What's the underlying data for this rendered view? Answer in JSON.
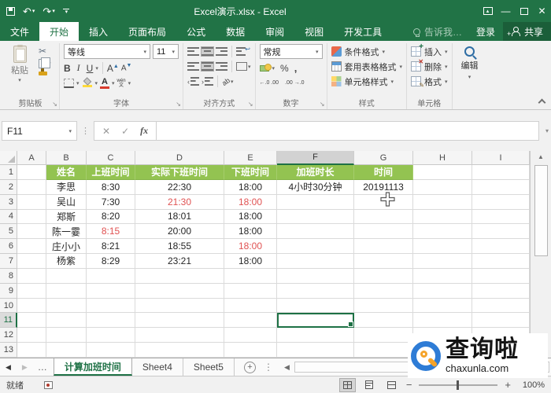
{
  "window": {
    "title": "Excel演示.xlsx - Excel"
  },
  "icons": {
    "undo": "↶",
    "redo": "↷",
    "dropdown": "▾",
    "close": "✕",
    "minimize": "—",
    "check": "✓",
    "cancel": "✕",
    "fx": "fx",
    "dots_v": "⋮",
    "ellipsis": "…",
    "tri_left": "◀",
    "tri_right": "▶",
    "up": "▲",
    "down": "▼",
    "scissors": "✂",
    "percent": "%",
    "comma": ",",
    "plus": "+",
    "minus": "−",
    "indent_left": "‹",
    "indent_right": "›",
    "wrap_return": "↩",
    "dec_increase": "←.0 .00",
    "dec_decrease": ".00 →.0",
    "launcher": "↘",
    "ribbon_display": "▴"
  },
  "tabs": {
    "file": "文件",
    "items": [
      "开始",
      "插入",
      "页面布局",
      "公式",
      "数据",
      "审阅",
      "视图",
      "开发工具"
    ],
    "active": "开始",
    "tell_me": "告诉我…",
    "sign_in": "登录",
    "share": "共享"
  },
  "ribbon": {
    "clipboard": {
      "paste_label": "粘贴",
      "group_label": "剪贴板"
    },
    "font": {
      "family": "等线",
      "size": "11",
      "bold": "B",
      "italic": "I",
      "underline": "U",
      "grow": "A",
      "shrink": "A",
      "phonetic_top": "wén",
      "phonetic_bottom": "文",
      "font_color_letter": "A",
      "group_label": "字体",
      "fill_color": "#FFDA3A",
      "font_color": "#D83B2D"
    },
    "alignment": {
      "group_label": "对齐方式",
      "orientation_label": "ab"
    },
    "number": {
      "format": "常规",
      "group_label": "数字"
    },
    "styles": {
      "items": [
        "条件格式",
        "套用表格格式",
        "单元格样式"
      ],
      "group_label": "样式"
    },
    "cells": {
      "items": [
        "插入",
        "删除",
        "格式"
      ],
      "group_label": "单元格"
    },
    "editing": {
      "label": "编辑"
    }
  },
  "formula_bar": {
    "name_box": "F11",
    "value": ""
  },
  "grid": {
    "columns": [
      "A",
      "B",
      "C",
      "D",
      "E",
      "F",
      "G",
      "H",
      "I"
    ],
    "rows": [
      "1",
      "2",
      "3",
      "4",
      "5",
      "6",
      "7",
      "8",
      "9",
      "10",
      "11",
      "12",
      "13"
    ],
    "selected": {
      "cell": "F11",
      "column": "F",
      "row": "11"
    },
    "table_header": {
      "B": "姓名",
      "C": "上班时间",
      "D": "实际下班时间",
      "E": "下班时间",
      "F": "加班时长",
      "G": "时间"
    },
    "data_rows": [
      {
        "row": "2",
        "B": "李思",
        "C": "8:30",
        "D": "22:30",
        "E": "18:00",
        "F": "4小时30分钟",
        "G": "20191113",
        "red": []
      },
      {
        "row": "3",
        "B": "吴山",
        "C": "7:30",
        "D": "21:30",
        "E": "18:00",
        "red": [
          "D",
          "E"
        ]
      },
      {
        "row": "4",
        "B": "郑斯",
        "C": "8:20",
        "D": "18:01",
        "E": "18:00",
        "red": []
      },
      {
        "row": "5",
        "B": "陈一霎",
        "C": "8:15",
        "D": "20:00",
        "E": "18:00",
        "red": [
          "C"
        ]
      },
      {
        "row": "6",
        "B": "庄小小",
        "C": "8:21",
        "D": "18:55",
        "E": "18:00",
        "red": [
          "E"
        ]
      },
      {
        "row": "7",
        "B": "杨紫",
        "C": "8:29",
        "D": "23:21",
        "E": "18:00",
        "red": []
      }
    ],
    "header_fill_color": "#93C351",
    "red_text_color": "#E05252"
  },
  "sheets": {
    "tabs": [
      "计算加班时间",
      "Sheet4",
      "Sheet5"
    ],
    "active": "计算加班时间"
  },
  "status": {
    "ready": "就绪",
    "zoom": "100%"
  },
  "watermark": {
    "name": "查询啦",
    "domain": "chaxunla.com"
  },
  "colors": {
    "excel_green": "#217346",
    "selection_green": "#1E7145"
  }
}
